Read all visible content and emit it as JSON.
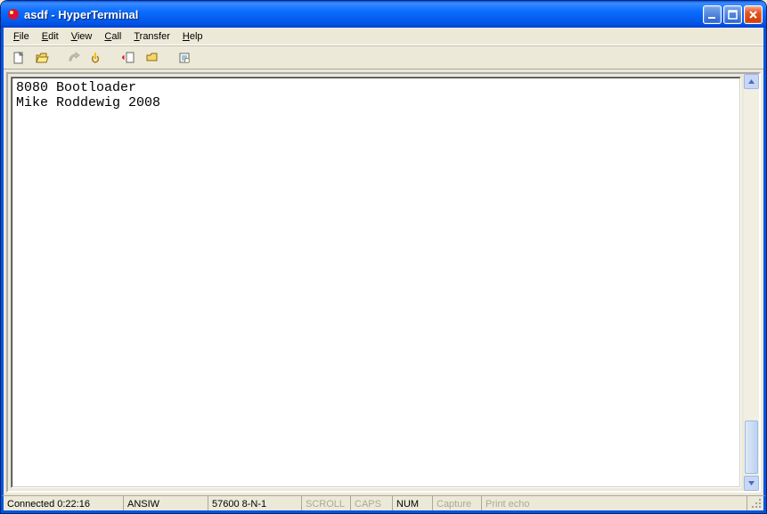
{
  "title": "asdf - HyperTerminal",
  "menus": {
    "file": "File",
    "edit": "Edit",
    "view": "View",
    "call": "Call",
    "transfer": "Transfer",
    "help": "Help"
  },
  "toolbar_icons": {
    "new": "new-file-icon",
    "open": "open-file-icon",
    "connect": "connect-icon",
    "disconnect": "disconnect-icon",
    "send": "send-icon",
    "receive": "receive-icon",
    "properties": "properties-icon"
  },
  "terminal": {
    "lines": [
      "8080 Bootloader",
      "Mike Roddewig 2008"
    ]
  },
  "status": {
    "connected": "Connected 0:22:16",
    "emulation": "ANSIW",
    "port": "57600 8-N-1",
    "scroll": "SCROLL",
    "caps": "CAPS",
    "num": "NUM",
    "capture": "Capture",
    "printecho": "Print echo"
  }
}
